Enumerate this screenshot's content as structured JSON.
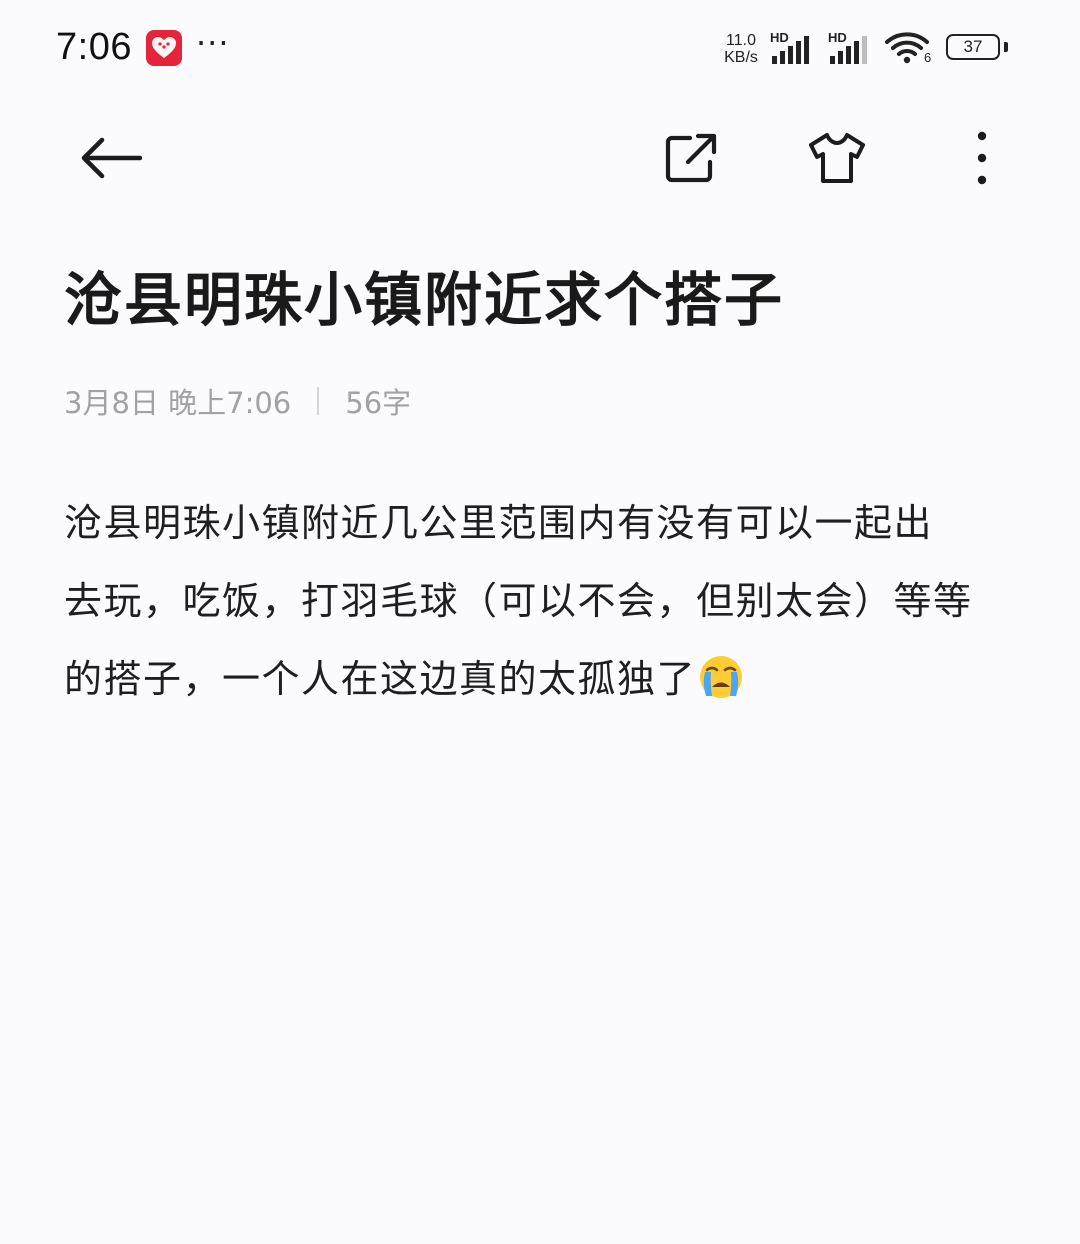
{
  "status_bar": {
    "time": "7:06",
    "overflow_indicator": "···",
    "net_speed_value": "11.0",
    "net_speed_unit": "KB/s",
    "sim1_label": "HD",
    "sim2_label": "HD",
    "wifi_label": "6",
    "battery_level": "37",
    "icons": [
      "app-notification-icon",
      "signal-icon",
      "signal-icon",
      "wifi-icon",
      "battery-icon"
    ]
  },
  "toolbar": {
    "icons": [
      "back-arrow-icon",
      "share-icon",
      "theme-shirt-icon",
      "more-vertical-icon"
    ]
  },
  "note": {
    "title": "沧县明珠小镇附近求个搭子",
    "date": "3月8日 晚上7:06",
    "word_count": "56字",
    "body_lines": [
      "沧县明珠小镇附近几公里范围内有没有可以一起出",
      "去玩，吃饭，打羽毛球（可以不会，但别太会）等等",
      "的搭子，一个人在这边真的太孤独了"
    ],
    "trailing_emoji": "loudly-crying-face"
  },
  "colors": {
    "background": "#fbfbfd",
    "text_primary": "#1d1d1f",
    "text_meta": "#a2a2a6",
    "app_badge": "#e3243b"
  }
}
